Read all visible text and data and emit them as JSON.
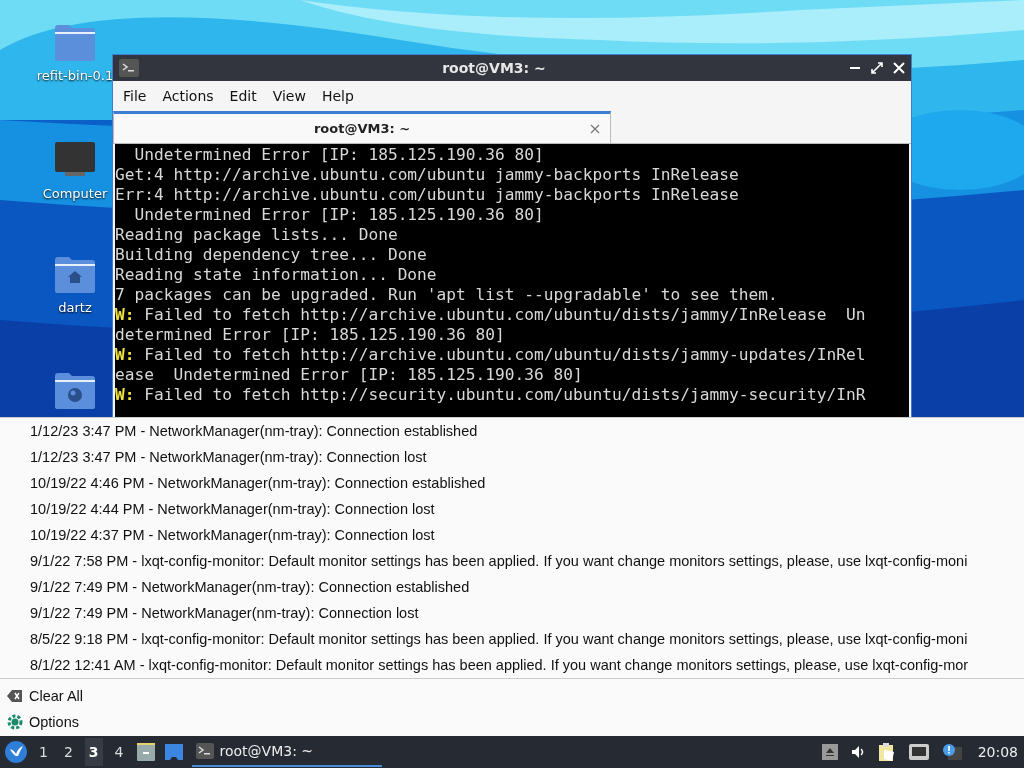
{
  "desktop": {
    "icons": [
      {
        "kind": "folder",
        "label": "refit-bin-0.1"
      },
      {
        "kind": "computer",
        "label": "Computer"
      },
      {
        "kind": "home",
        "label": "dartz"
      },
      {
        "kind": "network"
      }
    ]
  },
  "window": {
    "title": "root@VM3: ~",
    "menu": [
      "File",
      "Actions",
      "Edit",
      "View",
      "Help"
    ],
    "tabs": [
      {
        "label": "root@VM3: ~",
        "selected": true
      }
    ],
    "terminal_lines": [
      {
        "text": "  Undetermined Error [IP: 185.125.190.36 80]"
      },
      {
        "text": "Get:4 http://archive.ubuntu.com/ubuntu jammy-backports InRelease"
      },
      {
        "text": "Err:4 http://archive.ubuntu.com/ubuntu jammy-backports InRelease"
      },
      {
        "text": "  Undetermined Error [IP: 185.125.190.36 80]"
      },
      {
        "text": "Reading package lists... Done"
      },
      {
        "text": "Building dependency tree... Done"
      },
      {
        "text": "Reading state information... Done"
      },
      {
        "text": "7 packages can be upgraded. Run 'apt list --upgradable' to see them."
      },
      {
        "prefix": "W:",
        "text": " Failed to fetch http://archive.ubuntu.com/ubuntu/dists/jammy/InRelease  Un"
      },
      {
        "text": "determined Error [IP: 185.125.190.36 80]"
      },
      {
        "prefix": "W:",
        "text": " Failed to fetch http://archive.ubuntu.com/ubuntu/dists/jammy-updates/InRel"
      },
      {
        "text": "ease  Undetermined Error [IP: 185.125.190.36 80]"
      },
      {
        "prefix": "W:",
        "text": " Failed to fetch http://security.ubuntu.com/ubuntu/dists/jammy-security/InR"
      }
    ]
  },
  "notifications": [
    "1/12/23 3:47 PM - NetworkManager(nm-tray): Connection established",
    "1/12/23 3:47 PM - NetworkManager(nm-tray): Connection lost",
    "10/19/22 4:46 PM - NetworkManager(nm-tray): Connection established",
    "10/19/22 4:44 PM - NetworkManager(nm-tray): Connection lost",
    "10/19/22 4:37 PM - NetworkManager(nm-tray): Connection lost",
    "9/1/22 7:58 PM - lxqt-config-monitor: Default monitor settings has been applied. If you want change monitors settings, please, use lxqt-config-moni",
    "9/1/22 7:49 PM - NetworkManager(nm-tray): Connection established",
    "9/1/22 7:49 PM - NetworkManager(nm-tray): Connection lost",
    "8/5/22 9:18 PM - lxqt-config-monitor: Default monitor settings has been applied. If you want change monitors settings, please, use lxqt-config-moni",
    "8/1/22 12:41 AM - lxqt-config-monitor: Default monitor settings has been applied. If you want change monitors settings, please, use lxqt-config-mor"
  ],
  "actions": [
    {
      "kind": "clear",
      "label": "Clear All"
    },
    {
      "kind": "options",
      "label": "Options"
    }
  ],
  "taskbar": {
    "desktops": [
      {
        "label": "1",
        "selected": false
      },
      {
        "label": "2",
        "selected": false
      },
      {
        "label": "3",
        "selected": true
      },
      {
        "label": "4",
        "selected": false
      }
    ],
    "task": {
      "label": "root@VM3: ~",
      "selected": true
    },
    "clock": "20:08"
  }
}
